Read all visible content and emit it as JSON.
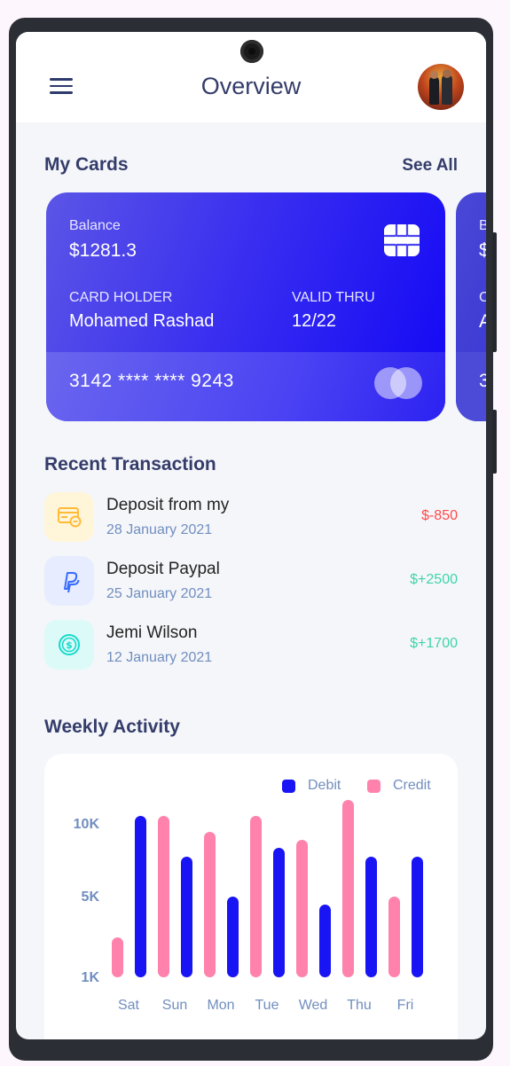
{
  "header": {
    "title": "Overview",
    "menu_icon": "hamburger-menu-icon",
    "avatar": "user-avatar"
  },
  "my_cards": {
    "title": "My Cards",
    "see_all": "See All",
    "cards": [
      {
        "balance_label": "Balance",
        "balance": "$1281.3",
        "holder_label": "CARD HOLDER",
        "holder": "Mohamed Rashad",
        "valid_label": "VALID THRU",
        "valid": "12/22",
        "number": "3142 **** **** 9243",
        "chip_icon": "card-chip-icon",
        "brand_icon": "mastercard-logo-icon"
      },
      {
        "balance_label": "B",
        "balance": "$",
        "holder_label": "C",
        "holder": "A",
        "number": "3"
      }
    ]
  },
  "recent": {
    "title": "Recent Transaction",
    "items": [
      {
        "name": "Deposit from my",
        "date": "28 January 2021",
        "amount": "$-850",
        "icon": "credit-card-icon",
        "amount_color": "#ff4b4a",
        "icon_bg": "#fff5d9",
        "icon_color": "#ffbb38"
      },
      {
        "name": "Deposit Paypal",
        "date": "25 January 2021",
        "amount": "$+2500",
        "icon": "paypal-icon",
        "amount_color": "#41d4a8",
        "icon_bg": "#e7edff",
        "icon_color": "#396aff"
      },
      {
        "name": "Jemi Wilson",
        "date": "12 January 2021",
        "amount": "$+1700",
        "icon": "dollar-coin-icon",
        "amount_color": "#41d4a8",
        "icon_bg": "#dcfaf8",
        "icon_color": "#16dbcc"
      }
    ]
  },
  "weekly": {
    "title": "Weekly Activity"
  },
  "chart_data": {
    "type": "bar",
    "categories": [
      "Sat",
      "Sun",
      "Mon",
      "Tue",
      "Wed",
      "Thu",
      "Fri"
    ],
    "series": [
      {
        "name": "Debit",
        "color": "#1814f3",
        "values": [
          10000,
          7500,
          5000,
          8000,
          4500,
          7500,
          7500
        ]
      },
      {
        "name": "Credit",
        "color": "#ff82ac",
        "values": [
          2500,
          10000,
          9000,
          10000,
          8500,
          11000,
          5000
        ]
      }
    ],
    "yticks": [
      "10K",
      "5K",
      "1K"
    ],
    "ylim": [
      0,
      11000
    ],
    "legend": "top-right",
    "grid": false
  },
  "colors": {
    "primary": "#1814f3",
    "title_text": "#343c6a",
    "muted_text": "#718ebf"
  }
}
